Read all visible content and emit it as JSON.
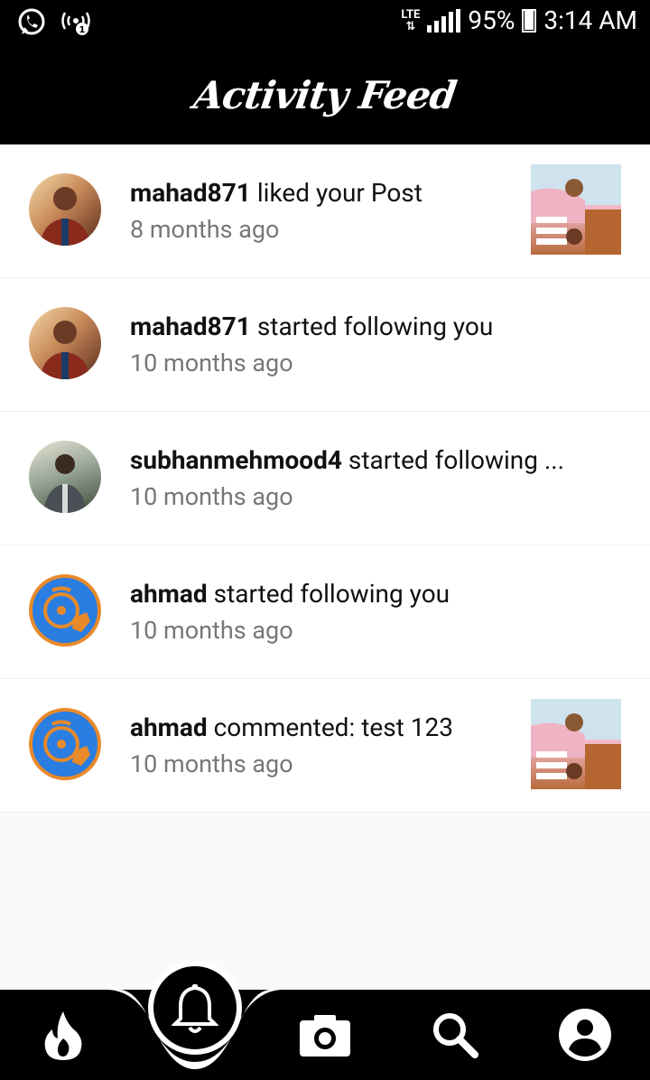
{
  "status_bar": {
    "network": "LTE",
    "battery": "95%",
    "time": "3:14 AM"
  },
  "header": {
    "title": "Activity Feed"
  },
  "feed": [
    {
      "username": "mahad871",
      "action": "liked your Post",
      "time": "8 months ago",
      "avatar": "photo",
      "has_thumbnail": true
    },
    {
      "username": "mahad871",
      "action": "started following you",
      "time": "10 months ago",
      "avatar": "photo",
      "has_thumbnail": false
    },
    {
      "username": "subhanmehmood4",
      "action": "started following ...",
      "time": "10 months ago",
      "avatar": "photo2",
      "has_thumbnail": false
    },
    {
      "username": "ahmad",
      "action": "started following you",
      "time": "10 months ago",
      "avatar": "disc",
      "has_thumbnail": false
    },
    {
      "username": "ahmad",
      "action": "commented: test 123",
      "time": "10 months ago",
      "avatar": "disc",
      "has_thumbnail": true
    }
  ],
  "bottom_nav": {
    "items": [
      {
        "icon": "flame-icon"
      },
      {
        "icon": "bell-icon",
        "active": true
      },
      {
        "icon": "camera-icon"
      },
      {
        "icon": "search-icon"
      },
      {
        "icon": "profile-icon"
      }
    ]
  },
  "colors": {
    "bar": "#000000",
    "background": "#fafafa",
    "disc_blue": "#2a7de1",
    "disc_orange": "#e88a2a"
  }
}
